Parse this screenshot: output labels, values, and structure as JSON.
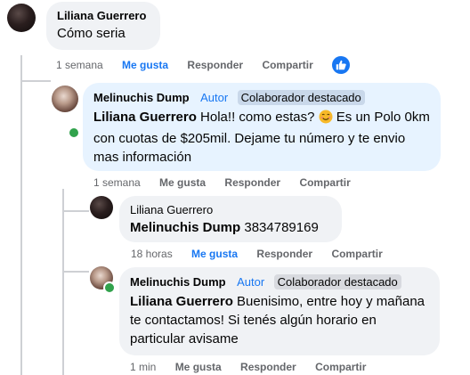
{
  "comments": [
    {
      "author": "Liliana Guerrero",
      "text": "Cómo seria",
      "time": "1 semana",
      "like": "Me gusta",
      "reply": "Responder",
      "share": "Compartir"
    },
    {
      "author": "Melinuchis Dump",
      "role": "Autor",
      "badge": "Colaborador destacado",
      "mention": "Liliana Guerrero",
      "text_before_emoji": "Hola!! como estas?",
      "emoji": "smiling-face-emoji",
      "text_after_emoji": "Es un Polo 0km con cuotas de $205mil. Dejame tu número y te envio mas información",
      "time": "1 semana",
      "like": "Me gusta",
      "reply": "Responder",
      "share": "Compartir"
    },
    {
      "author": "Liliana Guerrero",
      "mention": "Melinuchis Dump",
      "text": "3834789169",
      "time": "18 horas",
      "like": "Me gusta",
      "reply": "Responder",
      "share": "Compartir"
    },
    {
      "author": "Melinuchis Dump",
      "role": "Autor",
      "badge": "Colaborador destacado",
      "mention": "Liliana Guerrero",
      "text": "Buenisimo, entre hoy y mañana te contactamos! Si tenés algún horario en particular avisame",
      "time": "1 min",
      "like": "Me gusta",
      "reply": "Responder",
      "share": "Compartir"
    }
  ],
  "colors": {
    "accent": "#1877f2",
    "bubble_grey": "#f0f2f5",
    "bubble_blue": "#e7f3ff",
    "online": "#31a24c"
  }
}
